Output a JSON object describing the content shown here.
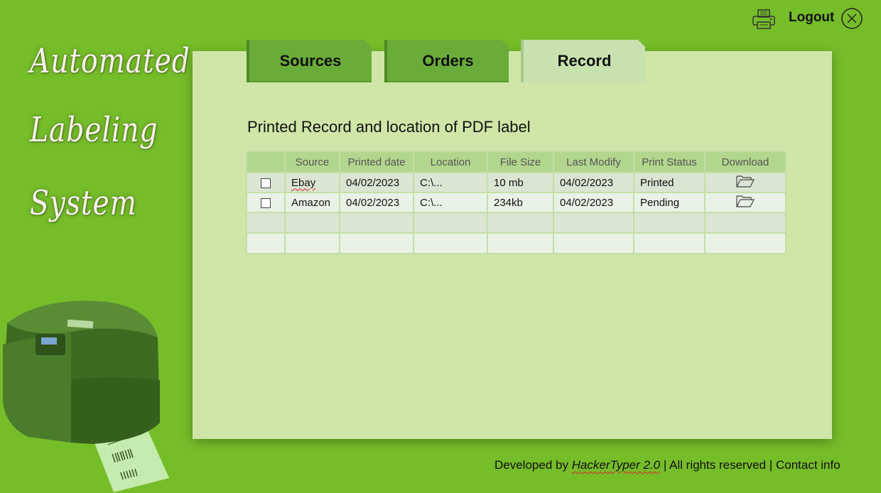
{
  "app_title": {
    "line1": "Automated",
    "line2": "Labeling",
    "line3": "System"
  },
  "topbar": {
    "print_icon": "printer-icon",
    "logout_label": "Logout",
    "close_icon": "close-circle-icon"
  },
  "tabs": [
    {
      "label": "Sources",
      "active": false
    },
    {
      "label": "Orders",
      "active": false
    },
    {
      "label": "Record",
      "active": true
    }
  ],
  "main": {
    "heading": "Printed Record and location of PDF label",
    "table": {
      "columns": [
        "",
        "Source",
        "Printed date",
        "Location",
        "File Size",
        "Last Modify",
        "Print Status",
        "Download"
      ],
      "rows": [
        {
          "checked": false,
          "source": "Ebay",
          "printed_date": "04/02/2023",
          "location": "C:\\...",
          "file_size": "10 mb",
          "last_modify": "04/02/2023",
          "print_status": "Printed",
          "download_icon": "folder-open-icon"
        },
        {
          "checked": false,
          "source": "Amazon",
          "printed_date": "04/02/2023",
          "location": "C:\\...",
          "file_size": "234kb",
          "last_modify": "04/02/2023",
          "print_status": "Pending",
          "download_icon": "folder-open-icon"
        }
      ]
    }
  },
  "footer": {
    "prefix": "Developed by",
    "brand": "HackerTyper 2.0",
    "rights": "| All rights reserved |",
    "contact": "Contact info"
  },
  "colors": {
    "background": "#76bd2a",
    "panel": "#cfe6a8",
    "tab_inactive": "#6aac3a",
    "tab_active": "#c7e2ae",
    "table_header": "#b3d68e"
  }
}
